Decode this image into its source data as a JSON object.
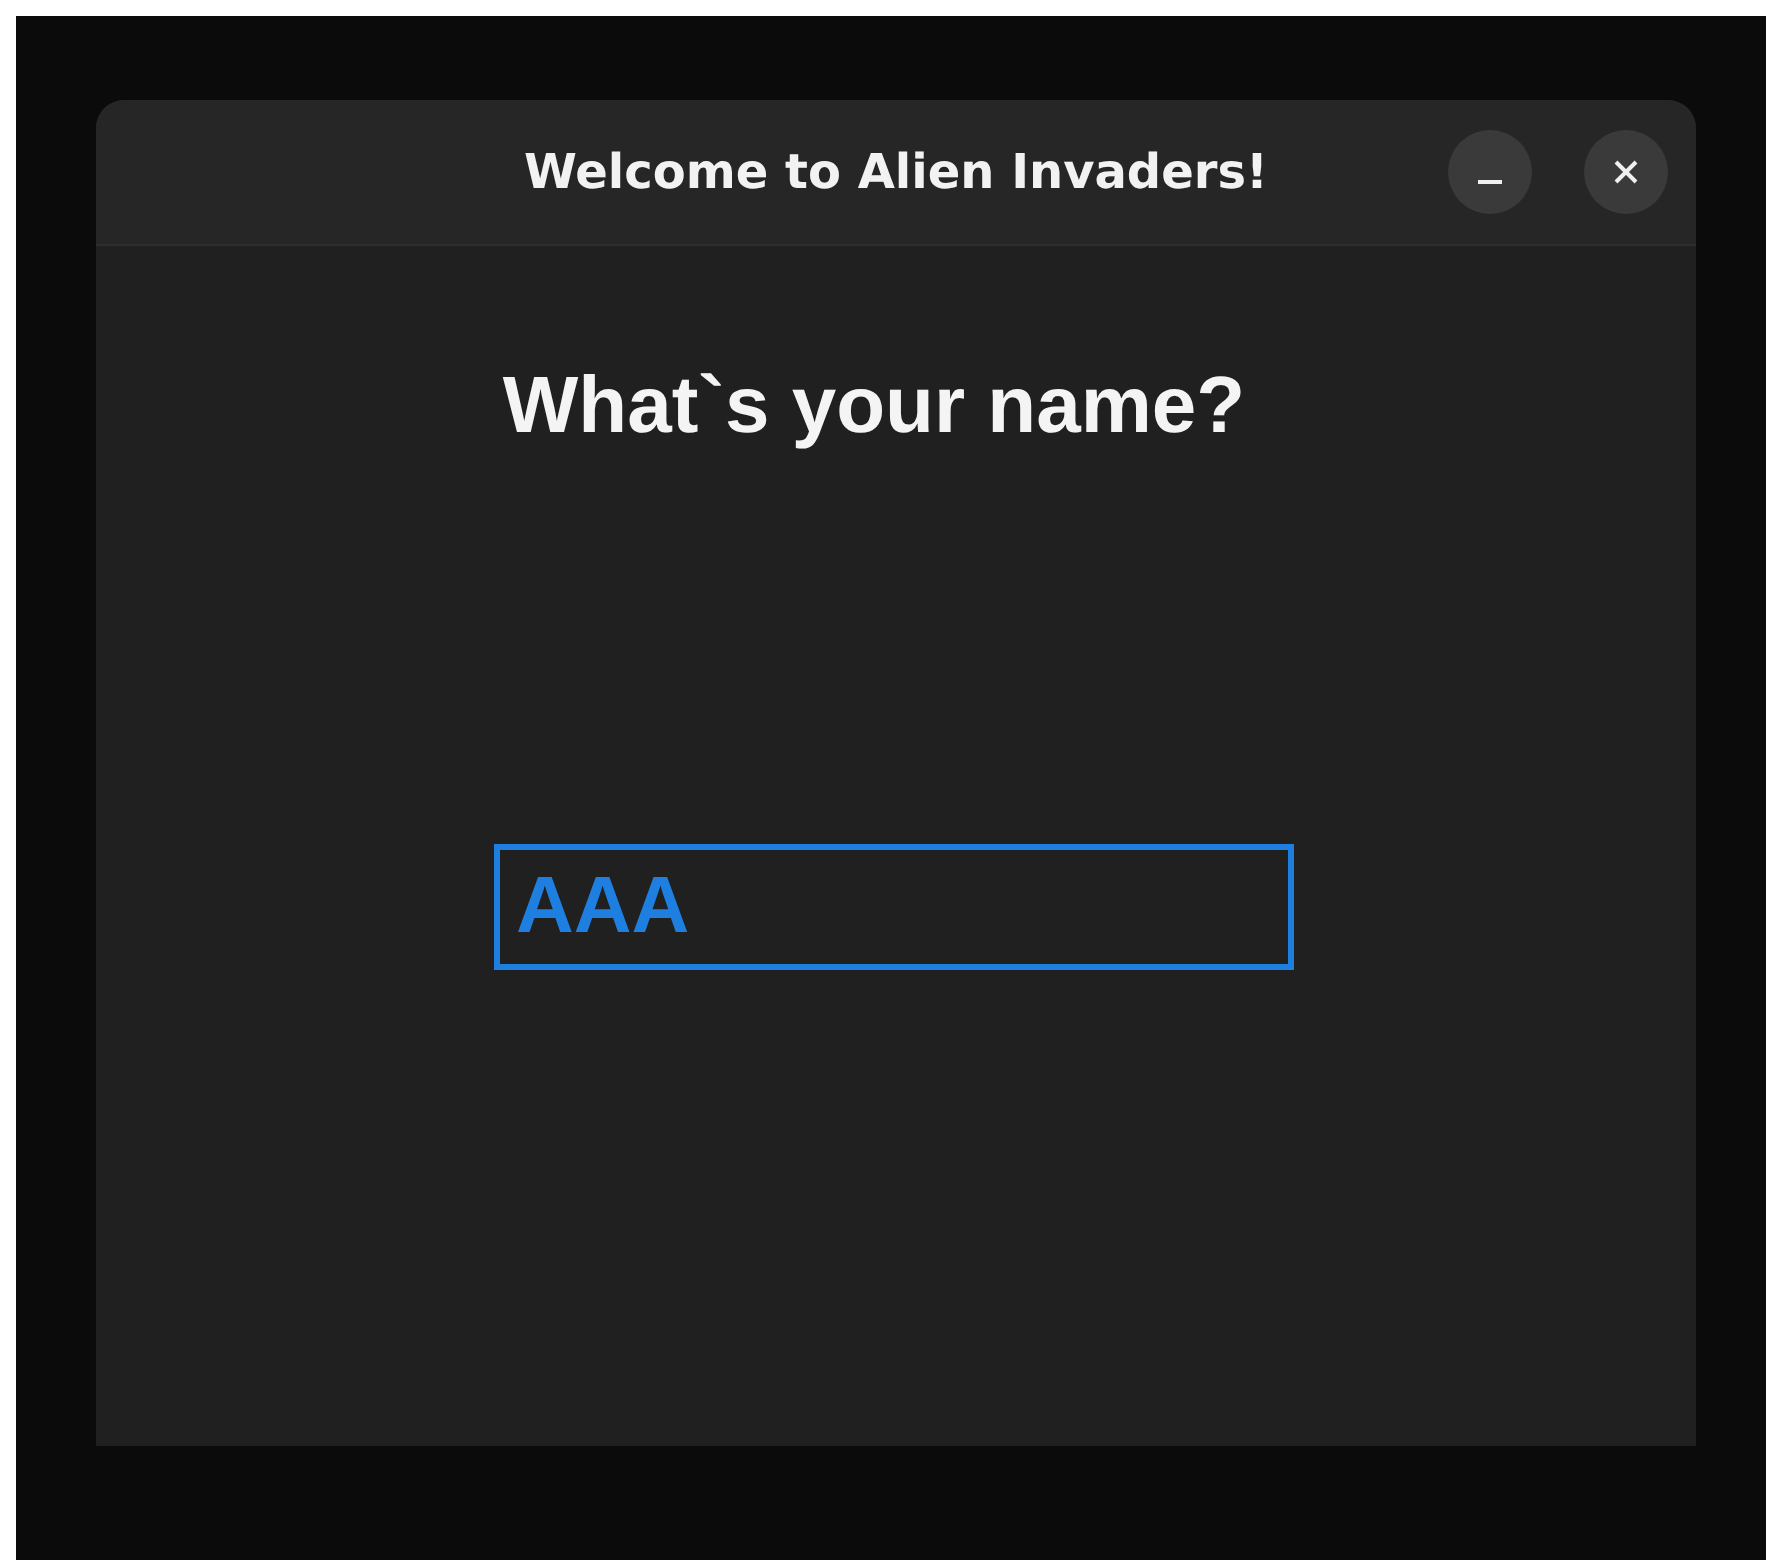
{
  "window": {
    "title": "Welcome to Alien Invaders!"
  },
  "heading": "What`s your name?",
  "name_field": {
    "value": "AAA",
    "focused": true
  }
}
